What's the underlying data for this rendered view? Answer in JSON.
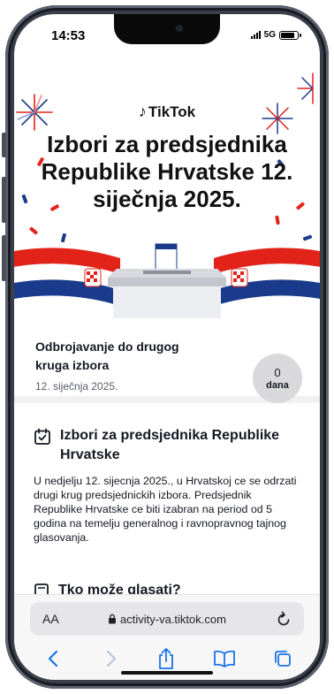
{
  "status_bar": {
    "time": "14:53",
    "network": "5G",
    "battery_level": 0.85
  },
  "banner": {
    "brand": "TikTok",
    "headline": "Izbori za predsjednika Republike Hrvatske 12. siječnja 2025."
  },
  "countdown": {
    "title": "Odbrojavanje do drugog kruga izbora",
    "date": "12. siječnja 2025.",
    "days_value": "0",
    "days_unit": "dana"
  },
  "election_section": {
    "title": "Izbori za predsjednika Republike Hrvatske",
    "body": "U nedjelju 12. sijecnja 2025., u Hrvatskoj ce se odrzati drugi krug predsjednickih izbora. Predsjednik Republike Hrvatske ce biti izabran na period od 5 godina na temelju generalnog i ravnopravnog tajnog glasovanja."
  },
  "next_section": {
    "title_partial": "Tko može glasati?"
  },
  "safari": {
    "text_size_label": "AA",
    "url": "activity-va.tiktok.com",
    "toolbar": [
      "back-icon",
      "forward-icon",
      "share-icon",
      "bookmarks-icon",
      "tabs-icon"
    ]
  },
  "colors": {
    "flag_red": "#e2231a",
    "flag_blue": "#1a3b8c",
    "accent_text": "#161823",
    "pill_bg": "#d9d9db"
  }
}
